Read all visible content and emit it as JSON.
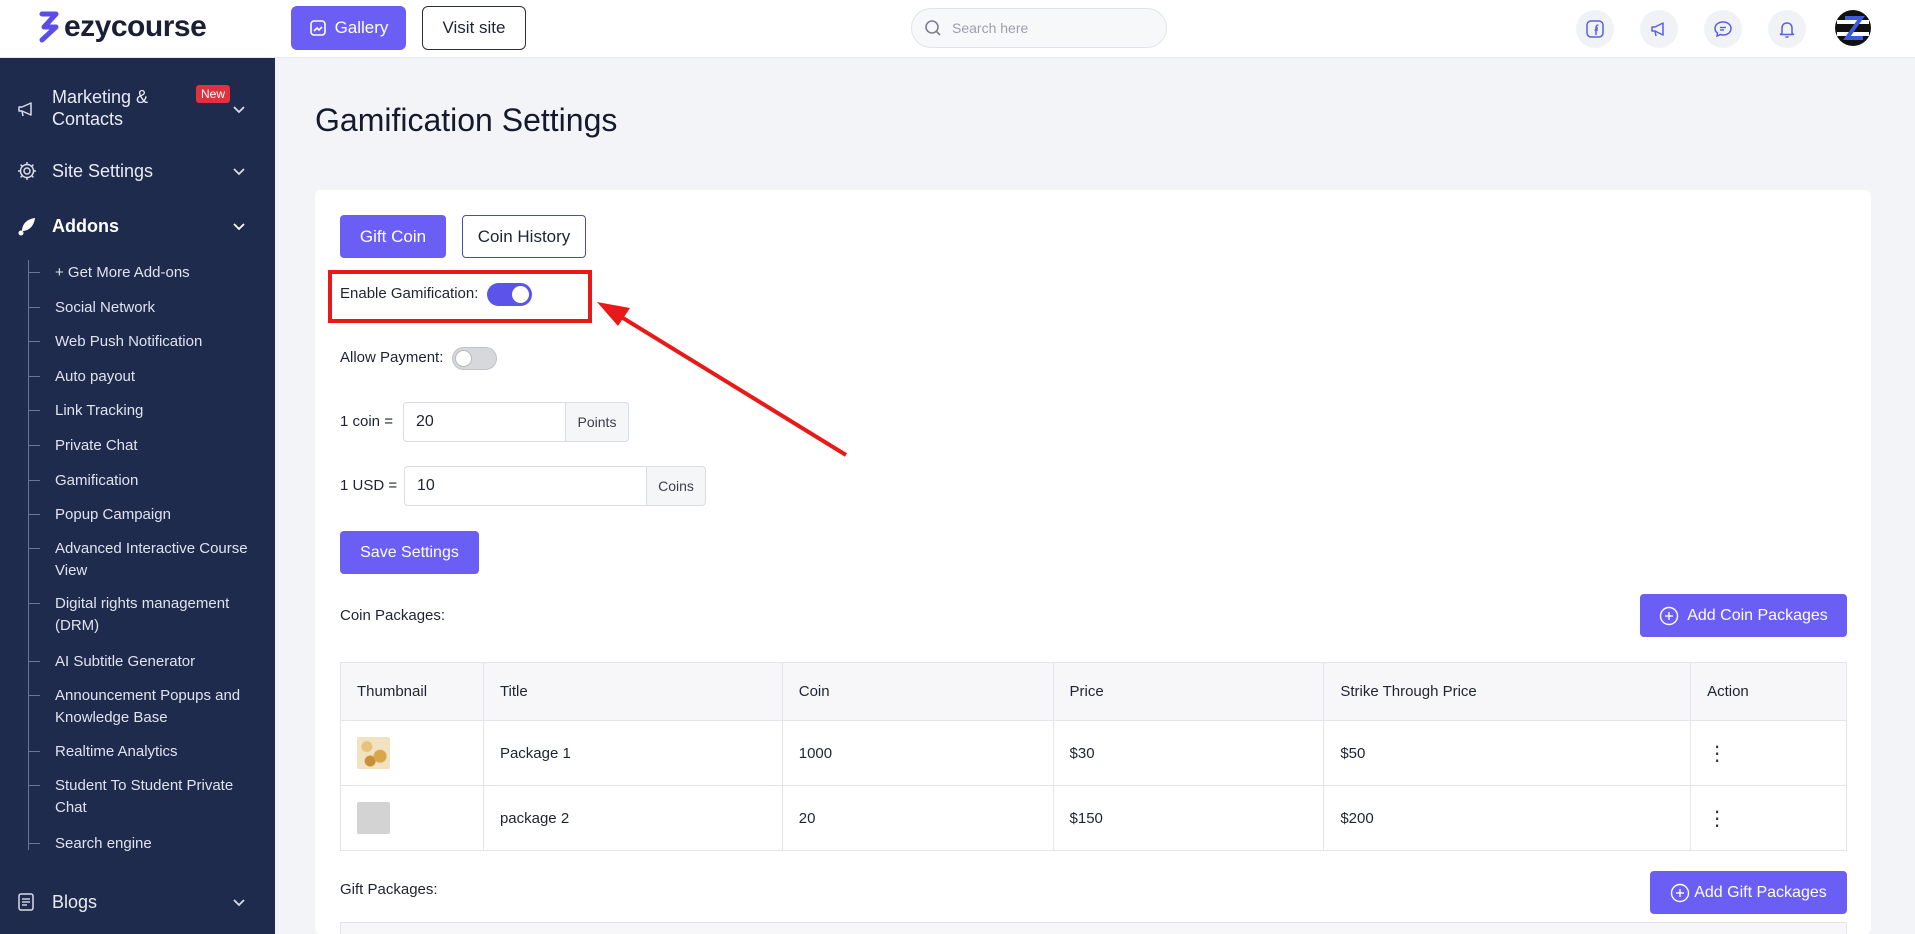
{
  "brand": {
    "name": "ezycourse"
  },
  "topbar": {
    "gallery_label": "Gallery",
    "visit_site_label": "Visit site",
    "search_placeholder": "Search here",
    "icons": [
      "facebook-icon",
      "megaphone-icon",
      "chat-icon",
      "bell-icon"
    ]
  },
  "sidebar": {
    "groups": [
      {
        "label": "Marketing & Contacts",
        "badge": "New",
        "icon": "megaphone-icon"
      },
      {
        "label": "Site Settings",
        "icon": "gear-icon"
      },
      {
        "label": "Addons",
        "icon": "rocket-icon"
      },
      {
        "label": "Blogs",
        "icon": "blog-icon"
      }
    ],
    "addons_items": [
      "+ Get More Add-ons",
      "Social Network",
      "Web Push Notification",
      "Auto payout",
      "Link Tracking",
      "Private Chat",
      "Gamification",
      "Popup Campaign",
      "Advanced Interactive Course View",
      "Digital rights management (DRM)",
      "AI Subtitle Generator",
      "Announcement Popups and Knowledge Base",
      "Realtime Analytics",
      "Student To Student Private Chat",
      "Search engine"
    ]
  },
  "page": {
    "title": "Gamification Settings",
    "tabs": {
      "gift_coin": "Gift Coin",
      "coin_history": "Coin History"
    },
    "enable_gamification_label": "Enable Gamification:",
    "enable_gamification_on": true,
    "allow_payment_label": "Allow Payment:",
    "allow_payment_on": false,
    "coin_rate": {
      "label": "1 coin =",
      "value": "20",
      "unit": "Points"
    },
    "usd_rate": {
      "label": "1 USD =",
      "value": "10",
      "unit": "Coins"
    },
    "save_label": "Save Settings",
    "coin_packages": {
      "label": "Coin Packages:",
      "add_label": "Add Coin Packages",
      "columns": [
        "Thumbnail",
        "Title",
        "Coin",
        "Price",
        "Strike Through Price",
        "Action"
      ],
      "rows": [
        {
          "title": "Package 1",
          "coin": "1000",
          "price": "$30",
          "strike": "$50"
        },
        {
          "title": "package 2",
          "coin": "20",
          "price": "$150",
          "strike": "$200"
        }
      ]
    },
    "gift_packages": {
      "label": "Gift Packages:",
      "add_label": "Add Gift Packages"
    }
  },
  "colors": {
    "accent": "#6a5ef5",
    "sidebar_bg": "#1f2b4d",
    "annotation": "#e81919"
  }
}
